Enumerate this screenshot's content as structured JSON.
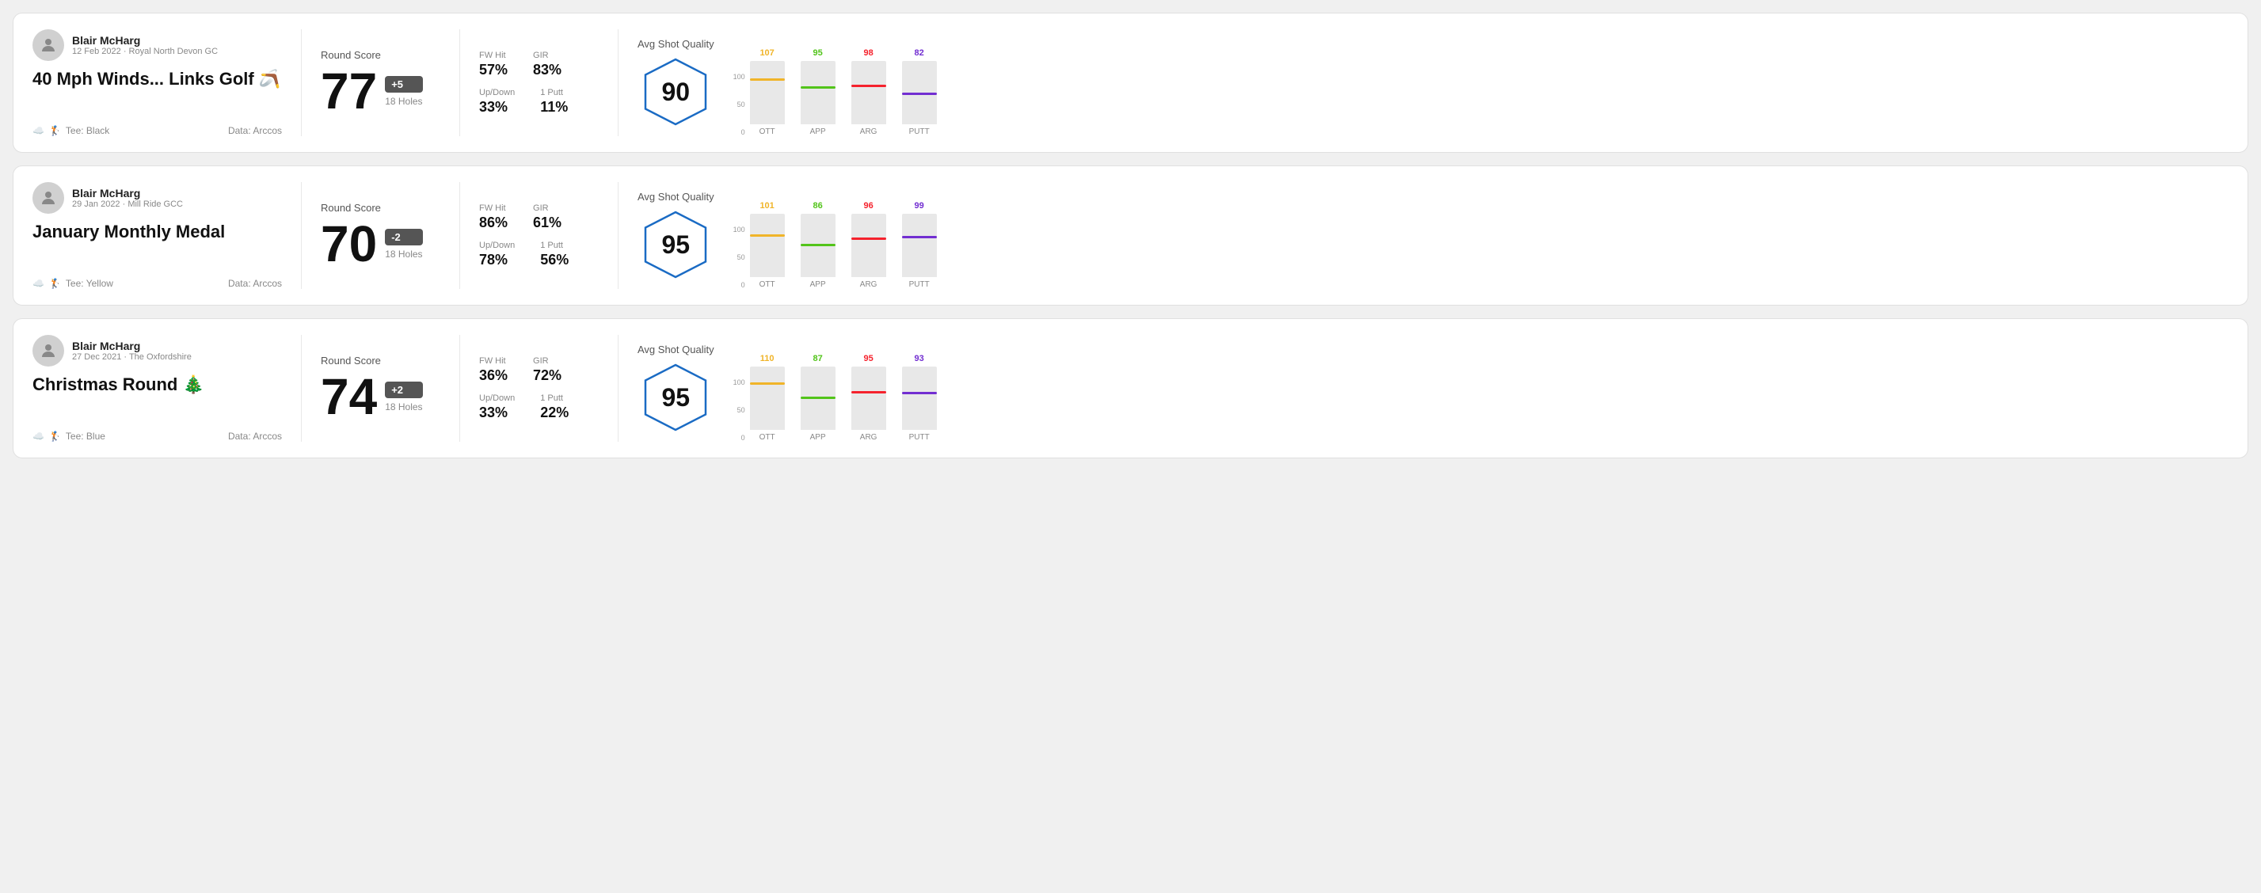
{
  "rounds": [
    {
      "id": "round-1",
      "player": {
        "name": "Blair McHarg",
        "date": "12 Feb 2022",
        "course": "Royal North Devon GC"
      },
      "title": "40 Mph Winds... Links Golf 🪃",
      "tee": "Black",
      "data_source": "Arccos",
      "score": {
        "label": "Round Score",
        "value": "77",
        "modifier": "+5",
        "holes": "18 Holes"
      },
      "stats": {
        "fw_hit_label": "FW Hit",
        "fw_hit_value": "57%",
        "gir_label": "GIR",
        "gir_value": "83%",
        "updown_label": "Up/Down",
        "updown_value": "33%",
        "oneputt_label": "1 Putt",
        "oneputt_value": "11%"
      },
      "quality": {
        "label": "Avg Shot Quality",
        "score": "90"
      },
      "chart": {
        "bars": [
          {
            "label": "OTT",
            "value": 107,
            "color": "#f0b429",
            "height_pct": 72
          },
          {
            "label": "APP",
            "value": 95,
            "color": "#52c41a",
            "height_pct": 60
          },
          {
            "label": "ARG",
            "value": 98,
            "color": "#f5222d",
            "height_pct": 63
          },
          {
            "label": "PUTT",
            "value": 82,
            "color": "#722ed1",
            "height_pct": 50
          }
        ],
        "y_labels": [
          "100",
          "50",
          "0"
        ]
      }
    },
    {
      "id": "round-2",
      "player": {
        "name": "Blair McHarg",
        "date": "29 Jan 2022",
        "course": "Mill Ride GCC"
      },
      "title": "January Monthly Medal",
      "tee": "Yellow",
      "data_source": "Arccos",
      "score": {
        "label": "Round Score",
        "value": "70",
        "modifier": "-2",
        "holes": "18 Holes"
      },
      "stats": {
        "fw_hit_label": "FW Hit",
        "fw_hit_value": "86%",
        "gir_label": "GIR",
        "gir_value": "61%",
        "updown_label": "Up/Down",
        "updown_value": "78%",
        "oneputt_label": "1 Putt",
        "oneputt_value": "56%"
      },
      "quality": {
        "label": "Avg Shot Quality",
        "score": "95"
      },
      "chart": {
        "bars": [
          {
            "label": "OTT",
            "value": 101,
            "color": "#f0b429",
            "height_pct": 67
          },
          {
            "label": "APP",
            "value": 86,
            "color": "#52c41a",
            "height_pct": 52
          },
          {
            "label": "ARG",
            "value": 96,
            "color": "#f5222d",
            "height_pct": 62
          },
          {
            "label": "PUTT",
            "value": 99,
            "color": "#722ed1",
            "height_pct": 65
          }
        ],
        "y_labels": [
          "100",
          "50",
          "0"
        ]
      }
    },
    {
      "id": "round-3",
      "player": {
        "name": "Blair McHarg",
        "date": "27 Dec 2021",
        "course": "The Oxfordshire"
      },
      "title": "Christmas Round 🎄",
      "tee": "Blue",
      "data_source": "Arccos",
      "score": {
        "label": "Round Score",
        "value": "74",
        "modifier": "+2",
        "holes": "18 Holes"
      },
      "stats": {
        "fw_hit_label": "FW Hit",
        "fw_hit_value": "36%",
        "gir_label": "GIR",
        "gir_value": "72%",
        "updown_label": "Up/Down",
        "updown_value": "33%",
        "oneputt_label": "1 Putt",
        "oneputt_value": "22%"
      },
      "quality": {
        "label": "Avg Shot Quality",
        "score": "95"
      },
      "chart": {
        "bars": [
          {
            "label": "OTT",
            "value": 110,
            "color": "#f0b429",
            "height_pct": 75
          },
          {
            "label": "APP",
            "value": 87,
            "color": "#52c41a",
            "height_pct": 53
          },
          {
            "label": "ARG",
            "value": 95,
            "color": "#f5222d",
            "height_pct": 61
          },
          {
            "label": "PUTT",
            "value": 93,
            "color": "#722ed1",
            "height_pct": 60
          }
        ],
        "y_labels": [
          "100",
          "50",
          "0"
        ]
      }
    }
  ]
}
